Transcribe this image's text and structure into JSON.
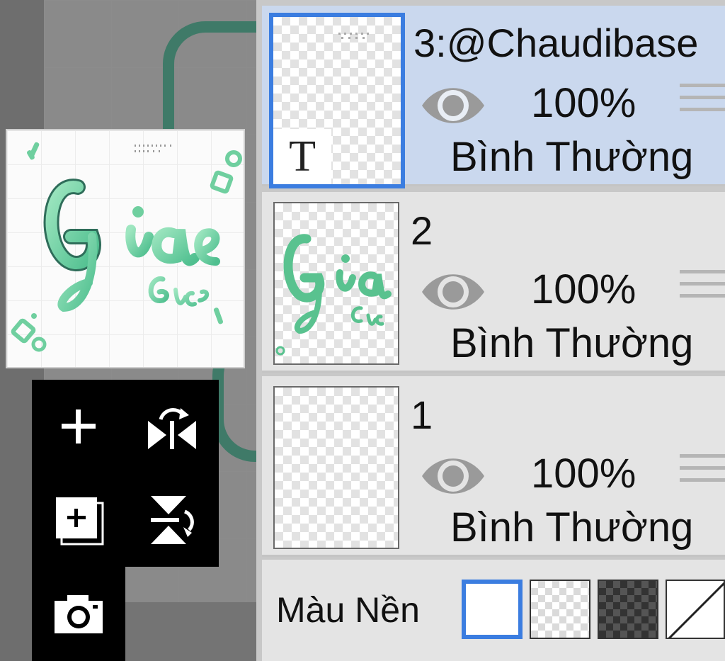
{
  "layers": [
    {
      "name": "3:@Chaudibase",
      "opacity": "100%",
      "blend": "Bình Thường",
      "type_badge": "T",
      "visible": true,
      "selected": true
    },
    {
      "name": "2",
      "opacity": "100%",
      "blend": "Bình Thường",
      "visible": true,
      "selected": false
    },
    {
      "name": "1",
      "opacity": "100%",
      "blend": "Bình Thường",
      "visible": true,
      "selected": false
    }
  ],
  "background": {
    "label": "Màu Nền",
    "options": [
      "white",
      "transparent-light",
      "transparent-dark",
      "none"
    ],
    "selected": "white"
  },
  "tools": [
    "add-layer-icon",
    "flip-horizontal-icon",
    "duplicate-layer-icon",
    "flip-vertical-icon",
    "camera-icon"
  ],
  "colors": {
    "accent": "#3b7de0",
    "selected_row": "#cad8ee",
    "row": "#e4e4e4",
    "artwork_green": "#6fcf9f"
  }
}
